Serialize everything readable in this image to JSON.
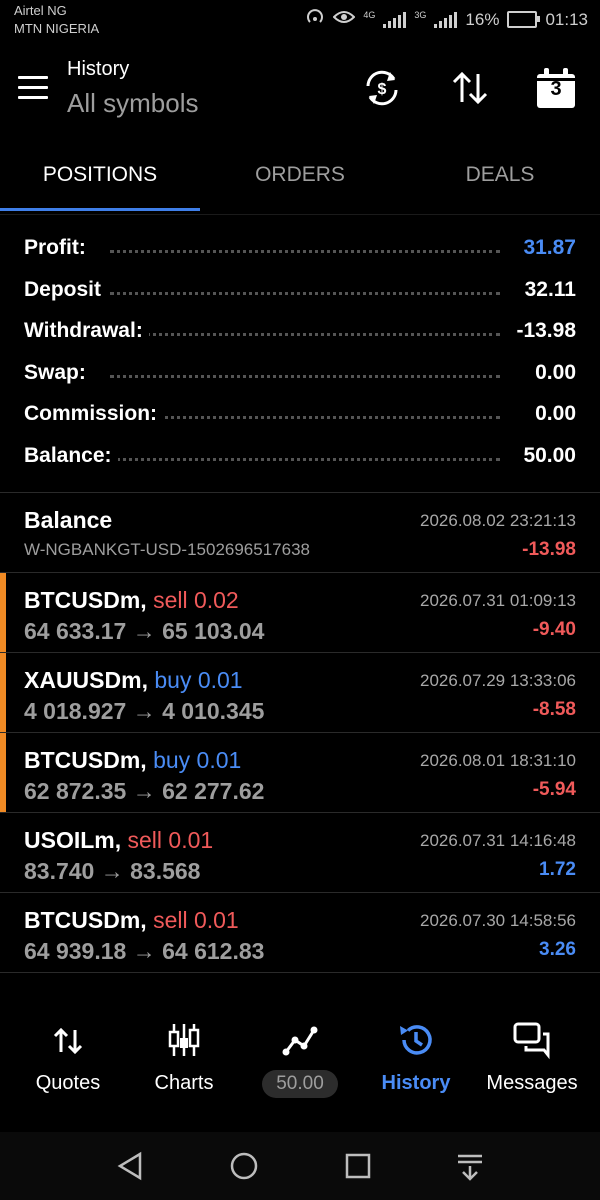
{
  "status_bar": {
    "carrier1": "Airtel NG",
    "carrier2": "MTN NIGERIA",
    "net1": "4G",
    "net2": "3G",
    "battery": "16%",
    "time": "01:13"
  },
  "app_bar": {
    "title": "History",
    "subtitle": "All symbols",
    "calendar_number": "3"
  },
  "tabs": [
    {
      "label": "POSITIONS",
      "active": true
    },
    {
      "label": "ORDERS",
      "active": false
    },
    {
      "label": "DEALS",
      "active": false
    }
  ],
  "summary": [
    {
      "label": "Profit:",
      "value": "31.87",
      "color": "#4a8cf5"
    },
    {
      "label": "Deposit",
      "value": "32.11"
    },
    {
      "label": "Withdrawal:",
      "value": "-13.98"
    },
    {
      "label": "Swap:",
      "value": "0.00"
    },
    {
      "label": "Commission:",
      "value": "0.00"
    },
    {
      "label": "Balance:",
      "value": "50.00"
    }
  ],
  "history": [
    {
      "symbol": "Balance",
      "side": "",
      "detail": "W-NGBANKGT-USD-1502696517638",
      "date": "2026.08.02 23:21:13",
      "value": "-13.98",
      "accent": false
    },
    {
      "symbol": "BTCUSDm,",
      "side": "sell 0.02",
      "detail": "64 633.17 → 65 103.04",
      "date": "2026.07.31 01:09:13",
      "value": "-9.40",
      "accent": true
    },
    {
      "symbol": "XAUUSDm,",
      "side": "buy 0.01",
      "detail": "4 018.927 → 4 010.345",
      "date": "2026.07.29 13:33:06",
      "value": "-8.58",
      "accent": true
    },
    {
      "symbol": "BTCUSDm,",
      "side": "buy 0.01",
      "detail": "62 872.35 → 62 277.62",
      "date": "2026.08.01 18:31:10",
      "value": "-5.94",
      "accent": true
    },
    {
      "symbol": "USOILm,",
      "side": "sell 0.01",
      "detail": "83.740 → 83.568",
      "date": "2026.07.31 14:16:48",
      "value": "1.72",
      "accent": false
    },
    {
      "symbol": "BTCUSDm,",
      "side": "sell 0.01",
      "detail": "64 939.18 → 64 612.83",
      "date": "2026.07.30 14:58:56",
      "value": "3.26",
      "accent": false
    }
  ],
  "bottom_nav": {
    "quotes": "Quotes",
    "charts": "Charts",
    "trade_value": "50.00",
    "history": "History",
    "messages": "Messages"
  },
  "colors": {
    "accent_blue": "#4a8cf5",
    "loss_red": "#f05a5a",
    "position_marker": "#f08a24"
  }
}
